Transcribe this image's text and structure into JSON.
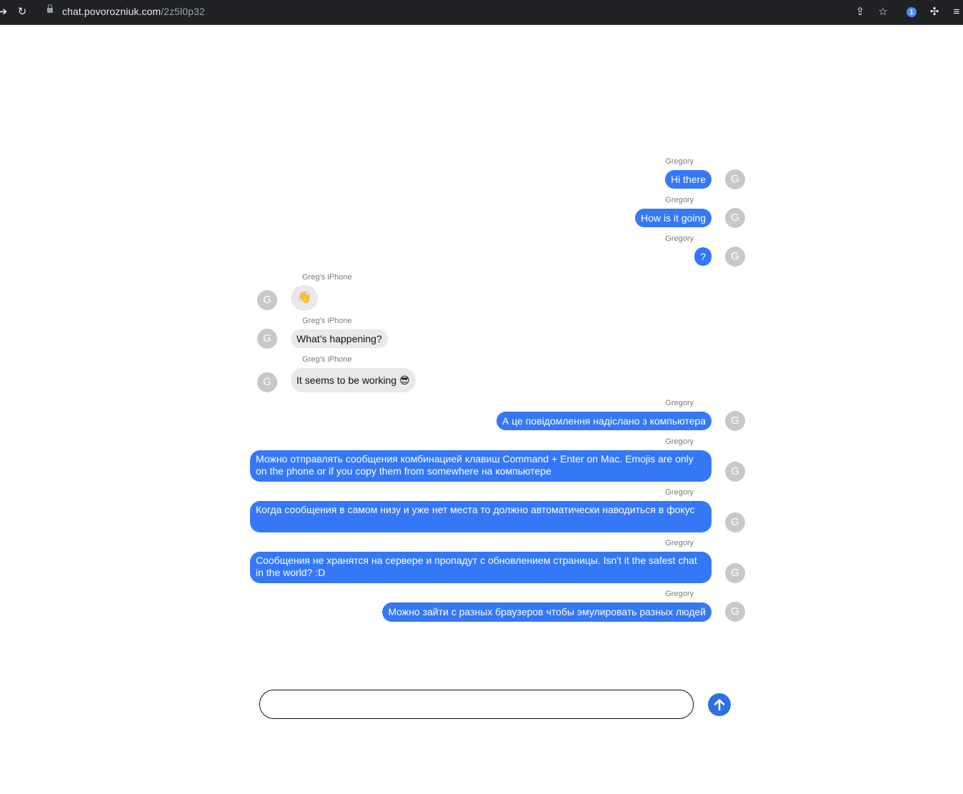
{
  "browser": {
    "url_domain": "chat.povorozniuk.com",
    "url_path": "/2z5l0p32",
    "icons": [
      "back-icon",
      "reload-icon",
      "lock-icon",
      "share-icon",
      "bookmark-star-icon",
      "password-manager-icon",
      "extensions-icon",
      "media-controls-icon"
    ]
  },
  "chat": {
    "messages": [
      {
        "sender": "Gregory",
        "text": "Hi there",
        "avatar": "G",
        "direction": "outgoing"
      },
      {
        "sender": "Gregory",
        "text": "How is it going",
        "avatar": "G",
        "direction": "outgoing"
      },
      {
        "sender": "Gregory",
        "text": "?",
        "avatar": "G",
        "direction": "outgoing"
      },
      {
        "sender": "Greg’s iPhone",
        "text": "👋",
        "avatar": "G",
        "direction": "incoming"
      },
      {
        "sender": "Greg’s iPhone",
        "text": "What’s happening?",
        "avatar": "G",
        "direction": "incoming"
      },
      {
        "sender": "Greg’s iPhone",
        "text": "It seems to be working 😎",
        "avatar": "G",
        "direction": "incoming"
      },
      {
        "sender": "Gregory",
        "text": "А це повідомлення надіслано з компьютера",
        "avatar": "G",
        "direction": "outgoing"
      },
      {
        "sender": "Gregory",
        "text": "Можно отправлять сообщения комбинацией клавиш Command + Enter on Mac. Emojis are only on the phone or if you copy them from somewhere на компьютере",
        "avatar": "G",
        "direction": "outgoing"
      },
      {
        "sender": "Gregory",
        "text": "Когда сообщения в самом низу и уже нет места то должно автоматически наводиться в фокус",
        "avatar": "G",
        "direction": "outgoing"
      },
      {
        "sender": "Gregory",
        "text": "Сообщения не хранятся на сервере и пропадут с обновлением страницы. Isn't it the safest chat in the world? :D",
        "avatar": "G",
        "direction": "outgoing"
      },
      {
        "sender": "Gregory",
        "text": "Можно зайти с разных браузеров чтобы эмулировать разных людей",
        "avatar": "G",
        "direction": "outgoing"
      }
    ]
  },
  "composer": {
    "value": "",
    "placeholder": ""
  },
  "colors": {
    "outgoing_bubble": "#3478f6",
    "incoming_bubble": "#e9e9eb",
    "send_button": "#2f6fe0",
    "avatar": "#c8c8c8"
  }
}
